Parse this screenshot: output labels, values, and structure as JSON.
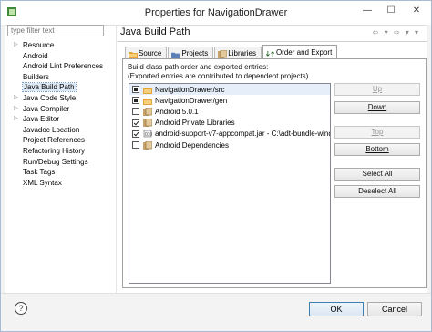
{
  "window": {
    "title": "Properties for NavigationDrawer",
    "min_glyph": "—",
    "max_glyph": "☐",
    "close_glyph": "✕"
  },
  "sidebar": {
    "filter_placeholder": "type filter text",
    "items": [
      {
        "label": "Resource",
        "expandable": true
      },
      {
        "label": "Android",
        "expandable": false
      },
      {
        "label": "Android Lint Preferences",
        "expandable": false
      },
      {
        "label": "Builders",
        "expandable": false
      },
      {
        "label": "Java Build Path",
        "expandable": false,
        "selected": true
      },
      {
        "label": "Java Code Style",
        "expandable": true
      },
      {
        "label": "Java Compiler",
        "expandable": true
      },
      {
        "label": "Java Editor",
        "expandable": true
      },
      {
        "label": "Javadoc Location",
        "expandable": false
      },
      {
        "label": "Project References",
        "expandable": false
      },
      {
        "label": "Refactoring History",
        "expandable": false
      },
      {
        "label": "Run/Debug Settings",
        "expandable": false
      },
      {
        "label": "Task Tags",
        "expandable": false
      },
      {
        "label": "XML Syntax",
        "expandable": false
      }
    ]
  },
  "page": {
    "title": "Java Build Path",
    "nav_glyphs": "⇦ ▾ ⇨ ▾ ▾",
    "tabs": [
      {
        "label": "Source",
        "icon": "source-folder-icon"
      },
      {
        "label": "Projects",
        "icon": "projects-icon"
      },
      {
        "label": "Libraries",
        "icon": "libraries-icon"
      },
      {
        "label": "Order and Export",
        "icon": "order-export-icon",
        "active": true
      }
    ],
    "description_line1": "Build class path order and exported entries:",
    "description_line2": "(Exported entries are contributed to dependent projects)",
    "entries": [
      {
        "label": "NavigationDrawer/src",
        "check": "partial",
        "icon": "source-folder-icon",
        "selected": true
      },
      {
        "label": "NavigationDrawer/gen",
        "check": "partial",
        "icon": "source-folder-icon"
      },
      {
        "label": "Android 5.0.1",
        "check": "none",
        "icon": "library-icon"
      },
      {
        "label": "Android Private Libraries",
        "check": "checked",
        "icon": "library-icon"
      },
      {
        "label": "android-support-v7-appcompat.jar - C:\\adt-bundle-wind",
        "check": "checked",
        "icon": "jar-icon"
      },
      {
        "label": "Android Dependencies",
        "check": "none",
        "icon": "library-icon"
      }
    ],
    "buttons": {
      "up": "Up",
      "down": "Down",
      "top": "Top",
      "bottom": "Bottom",
      "select_all": "Select All",
      "deselect_all": "Deselect All"
    }
  },
  "footer": {
    "help_glyph": "?",
    "ok": "OK",
    "cancel": "Cancel"
  },
  "colors": {
    "selection": "#dde8f5",
    "default_button_border": "#3c7fb1",
    "folder_icon": "#e8a33b"
  }
}
